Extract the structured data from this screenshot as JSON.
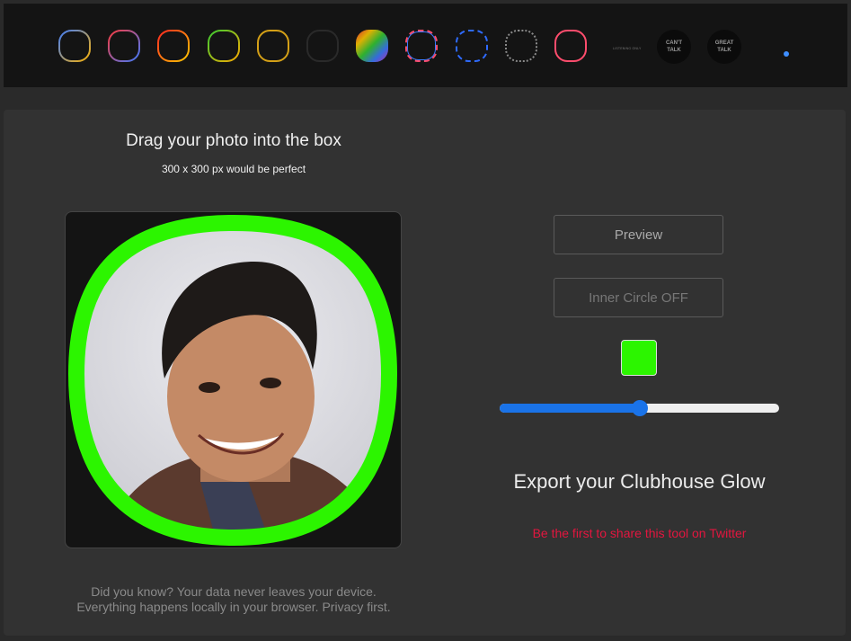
{
  "frames": [
    {
      "name": "frame-gradient-blue-yellow",
      "style": "gradient",
      "colors": [
        "#3b7bff",
        "#ffb300"
      ]
    },
    {
      "name": "frame-gradient-red-blue",
      "style": "gradient",
      "colors": [
        "#ff3a3a",
        "#3b7bff"
      ]
    },
    {
      "name": "frame-gradient-red-yellow",
      "style": "gradient",
      "colors": [
        "#ff2222",
        "#ffcc00"
      ]
    },
    {
      "name": "frame-gradient-green-orange",
      "style": "gradient",
      "colors": [
        "#33cc33",
        "#ffaa00"
      ]
    },
    {
      "name": "frame-solid-gold",
      "style": "solid",
      "colors": [
        "#d4a017"
      ]
    },
    {
      "name": "frame-solid-dark",
      "style": "solid",
      "colors": [
        "#2a2a2a"
      ]
    },
    {
      "name": "frame-rainbow",
      "style": "rainbow",
      "colors": [
        "#ff3333",
        "#ffcc00",
        "#33cc33",
        "#3b7bff",
        "#cc33cc"
      ]
    },
    {
      "name": "frame-dashed-red-blue",
      "style": "dashed",
      "colors": [
        "#ff4d6d",
        "#3b7bff"
      ]
    },
    {
      "name": "frame-dashed-blue",
      "style": "dashed",
      "colors": [
        "#2f6bff"
      ]
    },
    {
      "name": "frame-dotted-gray",
      "style": "dotted",
      "colors": [
        "#8a8a8a"
      ]
    },
    {
      "name": "frame-solid-pink",
      "style": "solid",
      "colors": [
        "#ff4d6d"
      ]
    }
  ],
  "badges": {
    "listening": "LISTENING ONLY",
    "cant_talk": "CAN'T TALK",
    "great_talk": "GREAT TALK"
  },
  "upload": {
    "title": "Drag your photo into the box",
    "subtitle": "300 x 300 px would be perfect"
  },
  "controls": {
    "preview_label": "Preview",
    "inner_circle_label": "Inner Circle OFF",
    "glow_color": "#2cf500",
    "slider_value": 0.5
  },
  "export": {
    "title": "Export your Clubhouse Glow",
    "share_link": "Be the first to share this tool on Twitter"
  },
  "note": {
    "line1": "Did you know? Your data never leaves your device.",
    "line2": "Everything happens locally in your browser. Privacy first."
  }
}
